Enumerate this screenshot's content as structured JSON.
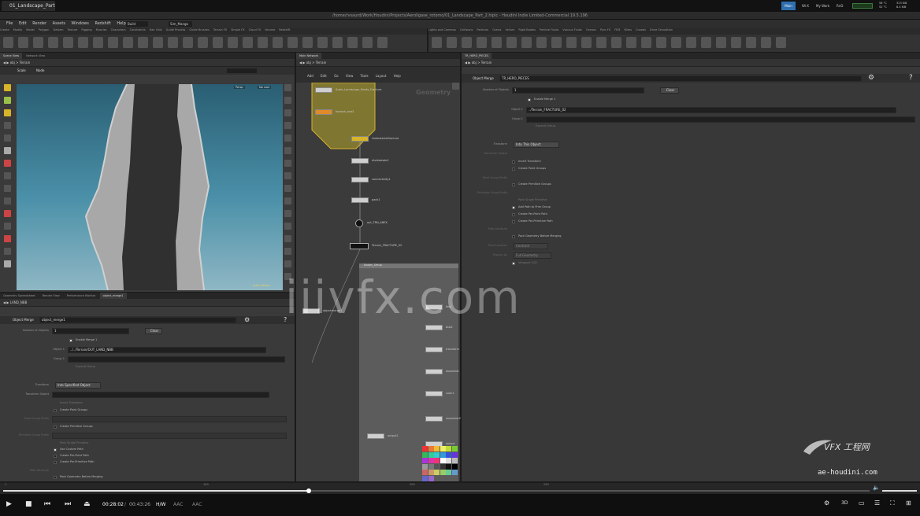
{
  "browser_tab": "01_Landscape_Part_2...",
  "window_title": "/home/rvsaurd/Work/Houdini/Projects/Aeroligase_rotomo/01_Landscape_Part_2.hiplc - Houdini Indie Limited-Commercial 19.5.196",
  "tray": {
    "items": [
      "Main",
      "Wi-X",
      "My Work",
      "RnD"
    ],
    "temps": [
      "58 °C",
      "52 °C"
    ],
    "sizes": [
      "323 KiB",
      "8.4 KiB"
    ]
  },
  "menu": [
    "File",
    "Edit",
    "Render",
    "Assets",
    "Windows",
    "Redshift",
    "Help"
  ],
  "menu_desktop": "Build",
  "menu_pane": "Sim_Mango",
  "shelf_tabs_left": [
    "Create",
    "Modify",
    "Model",
    "Polygon",
    "Deform",
    "Texture",
    "Rigging",
    "Muscles",
    "Characters",
    "Constraints",
    "Hair Utils",
    "Guide Process",
    "Guide Brushes",
    "Terrain FX",
    "Simple FX",
    "Cloud FX",
    "Volume",
    "Redshift"
  ],
  "shelf_tabs_right": [
    "Lights and Cameras",
    "Collisions",
    "Particles",
    "Grains",
    "Vellum",
    "Rigid Bodies",
    "Particle Fluids",
    "Viscous Fluids",
    "Oceans",
    "Pyro FX",
    "FEM",
    "Wires",
    "Crowds",
    "Drive Simulation"
  ],
  "viewport": {
    "tabs": [
      "Scene View",
      "Network View"
    ],
    "path": "obj > Terrain",
    "toolbar_mode": "Scale",
    "toolbar_mode2": "Node",
    "camera_btn": "Persp",
    "camera_btn2": "No cam",
    "bottom_label": "Indie Edition"
  },
  "left_params": {
    "tabs": [
      "Geometry Spreadsheet",
      "Render View",
      "Performance Monitor",
      "object_merge1"
    ],
    "path": "LAND_NBB",
    "node_type": "Object Merge",
    "node_name": "object_merge1",
    "num_objects_label": "Number of Objects",
    "num_objects": "1",
    "clear": "Clear",
    "enable_merge": "Enable Merge 1",
    "object1_label": "Object 1",
    "object1_value": "../../Terrain/OUT_LAND_NBB",
    "group1_label": "Group 1",
    "expand_group": "Expand Group",
    "transform_label": "Transform",
    "transform_value": "Into Specified Object",
    "transform_obj_label": "Transform Object",
    "invert": "Invert Transform",
    "create_point_groups": "Create Point Groups",
    "point_group_prefix": "Point Group Prefix",
    "create_prim_groups": "Create Primitive Groups",
    "prim_group_prefix": "Primitive Group Prefix",
    "pack_single": "Pack Single Primitive",
    "use_custom_path": "Use Custom Path",
    "create_per_point": "Create Per-Point Path",
    "create_per_prim": "Create Per-Primitive Path",
    "path_attrib": "Path Attribute",
    "pack_geo": "Pack Geometry Before Merging"
  },
  "network": {
    "tabs": [
      "Main Network"
    ],
    "path": "obj > Terrain",
    "menu": [
      "Add",
      "Edit",
      "Go",
      "View",
      "Tools",
      "Layout",
      "Help"
    ],
    "context_label": "Geometry",
    "nodes": [
      {
        "name": "Scale_Landscape_Points_Fracture"
      },
      {
        "name": "foreach_end1"
      },
      {
        "name": "rbdmaterialfracture"
      },
      {
        "name": "dividestate1"
      },
      {
        "name": "connectivity1"
      },
      {
        "name": "pack1"
      },
      {
        "name": "out_TRN_ABEX"
      },
      {
        "name": "Terrain_FRACTURE_02"
      },
      {
        "name": "Terrain_FRACTURE"
      }
    ],
    "subnet_title": "Nodes_Setup",
    "subnet_nodes": [
      "foo1",
      "blast",
      "transform",
      "assemble",
      "color1",
      "assemble2",
      "output"
    ],
    "side_node": "objectmerge1",
    "bottom_node": "output1"
  },
  "right_params": {
    "tabs": [
      "TR_HERO_PIECES"
    ],
    "path": "obj > Terrain",
    "node_type": "Object Merge",
    "node_name": "TR_HERO_PIECES",
    "num_objects_label": "Number of Objects",
    "num_objects": "1",
    "clear": "Clear",
    "enable_merge": "Enable Merge 1",
    "object1_label": "Object 1",
    "object1_value": "../Terrain_FRACTURE_02",
    "group1_label": "Group 1",
    "expand_group": "Expand Group",
    "transform_label": "Transform",
    "transform_value": "Into This Object",
    "transform_obj_label": "Transform Object",
    "invert": "Invert Transform",
    "create_point_groups": "Create Point Groups",
    "point_group_prefix": "Point Group Prefix",
    "create_prim_groups": "Create Primitive Groups",
    "prim_group_prefix": "Primitive Group Prefix",
    "pack_single": "Pack Single Primitive",
    "add_path": "Add Path to Prim Group",
    "create_per_point": "Create Per-Point Path",
    "create_per_prim": "Create Per-Primitive Path",
    "path_attrib": "Path Attribute",
    "pack_geo": "Pack Geometry Before Merging",
    "pivot_label": "Pivot Location",
    "pivot_value": "Centroid",
    "display_label": "Display As",
    "display_value": "Full Geometry",
    "viewport_lod": "Viewport LOD"
  },
  "watermarks": {
    "center": "iiivfx.com",
    "logo": "VFX 工程网",
    "url": "ae-houdini.com"
  },
  "timeline": {
    "ticks": [
      "1",
      "100",
      "200",
      "250"
    ],
    "frame": "1"
  },
  "player": {
    "current": "00:28:02",
    "total": "00:43:26",
    "codec": "H/W",
    "audio": "AAC",
    "audio2": "AAC"
  },
  "colors": {
    "accent": "#d7b42a",
    "viewport_top": "#2a5e73",
    "viewport_bottom": "#8fb7c4",
    "tray_active": "#2f6fb0"
  }
}
